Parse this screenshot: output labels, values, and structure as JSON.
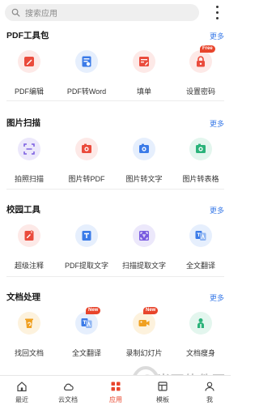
{
  "search": {
    "placeholder": "搜索应用"
  },
  "sections": [
    {
      "title": "PDF工具包",
      "more": "更多",
      "tools": [
        {
          "label": "PDF编辑",
          "icon": "pdf-edit-icon"
        },
        {
          "label": "PDF转Word",
          "icon": "pdf-to-word-icon"
        },
        {
          "label": "填单",
          "icon": "fill-form-icon"
        },
        {
          "label": "设置密码",
          "icon": "lock-icon",
          "badge": "Free"
        }
      ]
    },
    {
      "title": "图片扫描",
      "more": "更多",
      "tools": [
        {
          "label": "拍照扫描",
          "icon": "photo-scan-icon"
        },
        {
          "label": "图片转PDF",
          "icon": "image-to-pdf-icon"
        },
        {
          "label": "图片转文字",
          "icon": "image-to-text-icon"
        },
        {
          "label": "图片转表格",
          "icon": "image-to-table-icon"
        }
      ]
    },
    {
      "title": "校园工具",
      "more": "更多",
      "tools": [
        {
          "label": "超级注释",
          "icon": "annotate-icon"
        },
        {
          "label": "PDF提取文字",
          "icon": "pdf-extract-text-icon"
        },
        {
          "label": "扫描提取文字",
          "icon": "scan-extract-text-icon"
        },
        {
          "label": "全文翻译",
          "icon": "translate-icon"
        }
      ]
    },
    {
      "title": "文档处理",
      "more": "更多",
      "tools": [
        {
          "label": "找回文档",
          "icon": "recover-doc-icon"
        },
        {
          "label": "全文翻译",
          "icon": "translate-icon",
          "badge": "New"
        },
        {
          "label": "录制幻灯片",
          "icon": "record-slides-icon",
          "badge": "New"
        },
        {
          "label": "文档瘦身",
          "icon": "doc-slim-icon"
        }
      ]
    }
  ],
  "bottom_nav": [
    {
      "label": "最近",
      "icon": "home-icon",
      "active": false
    },
    {
      "label": "云文档",
      "icon": "cloud-icon",
      "active": false
    },
    {
      "label": "应用",
      "icon": "apps-grid-icon",
      "active": true
    },
    {
      "label": "模板",
      "icon": "template-icon",
      "active": false
    },
    {
      "label": "我",
      "icon": "user-icon",
      "active": false
    }
  ],
  "watermark": {
    "text": "当下软件园",
    "url": "www.downxia.com"
  },
  "colors": {
    "accent_red": "#e8452c",
    "link_blue": "#3b7be8"
  }
}
